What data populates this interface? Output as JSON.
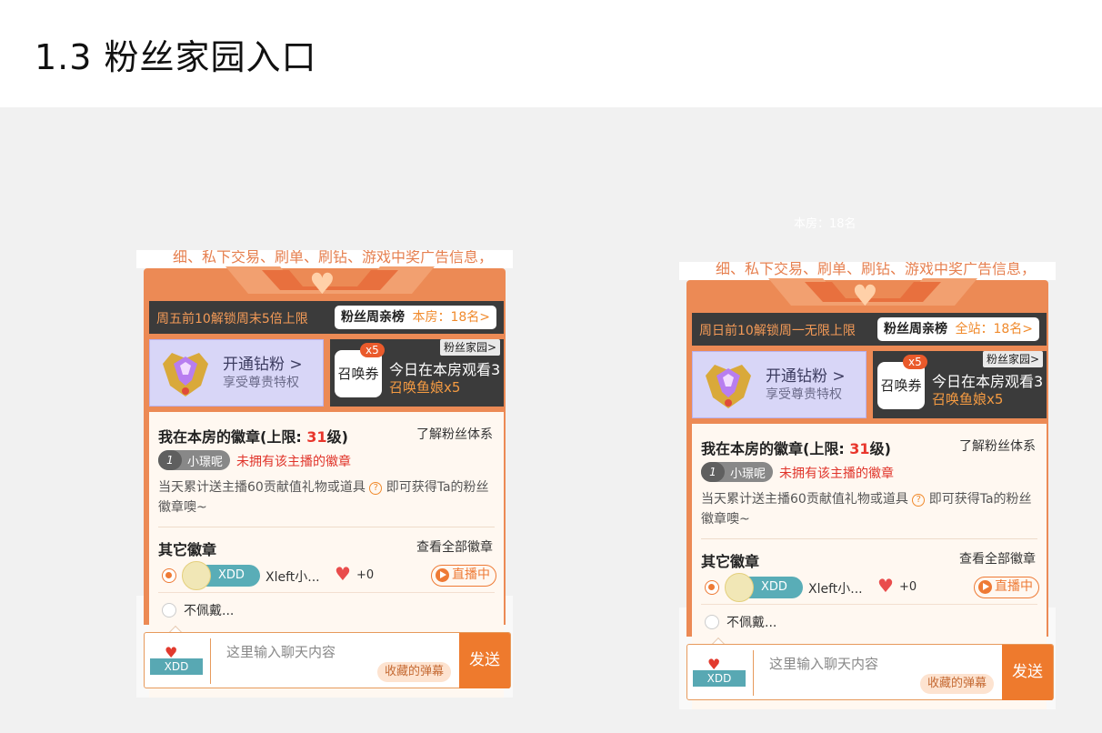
{
  "page": {
    "title": "1.3 粉丝家园入口"
  },
  "ghost_text": "本房：18名",
  "panels": [
    {
      "notice_text": "细、私下交易、刷单、刷钻、游戏中奖广告信息，",
      "week_notice": "周五前10解锁周末5倍上限",
      "rank": {
        "label": "粉丝周亲榜",
        "value": "本房：18名>"
      },
      "vip": {
        "title": "开通钻粉 >",
        "subtitle": "享受尊贵特权"
      },
      "summon": {
        "tag": "粉丝家园>",
        "coupon": "召唤券",
        "count": "x5",
        "title": "今日在本房观看3",
        "subtitle": "召唤鱼娘x5"
      },
      "badges": {
        "title_prefix": "我在本房的徽章(上限: ",
        "limit": "31",
        "title_suffix": "级)",
        "learn_link": "了解粉丝体系",
        "level": "1",
        "username": "小璟呢",
        "no_badge": "未拥有该主播的徽章",
        "desc": "当天累计送主播60贡献值礼物或道具",
        "desc_tail": "即可获得Ta的粉丝徽章噢~",
        "q_mark": "?",
        "other_title": "其它徽章",
        "all_link": "查看全部徽章",
        "fan_badge_name": "XDD",
        "anchor_name": "Xleft小...",
        "heart_plus": "+0",
        "live_label": "直播中",
        "no_wear": "不佩戴..."
      },
      "input": {
        "gift_label": "XDD",
        "placeholder": "这里输入聊天内容",
        "fav": "收藏的弹幕",
        "send": "发送"
      }
    },
    {
      "notice_text": "细、私下交易、刷单、刷钻、游戏中奖广告信息，",
      "week_notice": "周日前10解锁周一无限上限",
      "rank": {
        "label": "粉丝周亲榜",
        "value": "全站：18名>"
      },
      "vip": {
        "title": "开通钻粉 >",
        "subtitle": "享受尊贵特权"
      },
      "summon": {
        "tag": "粉丝家园>",
        "coupon": "召唤券",
        "count": "x5",
        "title": "今日在本房观看3",
        "subtitle": "召唤鱼娘x5"
      },
      "badges": {
        "title_prefix": "我在本房的徽章(上限: ",
        "limit": "31",
        "title_suffix": "级)",
        "learn_link": "了解粉丝体系",
        "level": "1",
        "username": "小璟呢",
        "no_badge": "未拥有该主播的徽章",
        "desc": "当天累计送主播60贡献值礼物或道具",
        "desc_tail": "即可获得Ta的粉丝徽章噢~",
        "q_mark": "?",
        "other_title": "其它徽章",
        "all_link": "查看全部徽章",
        "fan_badge_name": "XDD",
        "anchor_name": "Xleft小...",
        "heart_plus": "+0",
        "live_label": "直播中",
        "no_wear": "不佩戴..."
      },
      "input": {
        "gift_label": "XDD",
        "placeholder": "这里输入聊天内容",
        "fav": "收藏的弹幕",
        "send": "发送"
      }
    }
  ],
  "colors": {
    "accent": "#ee7a2d",
    "dark_bar": "#3b3b3b",
    "teal": "#59adb7",
    "red": "#e0342a"
  }
}
